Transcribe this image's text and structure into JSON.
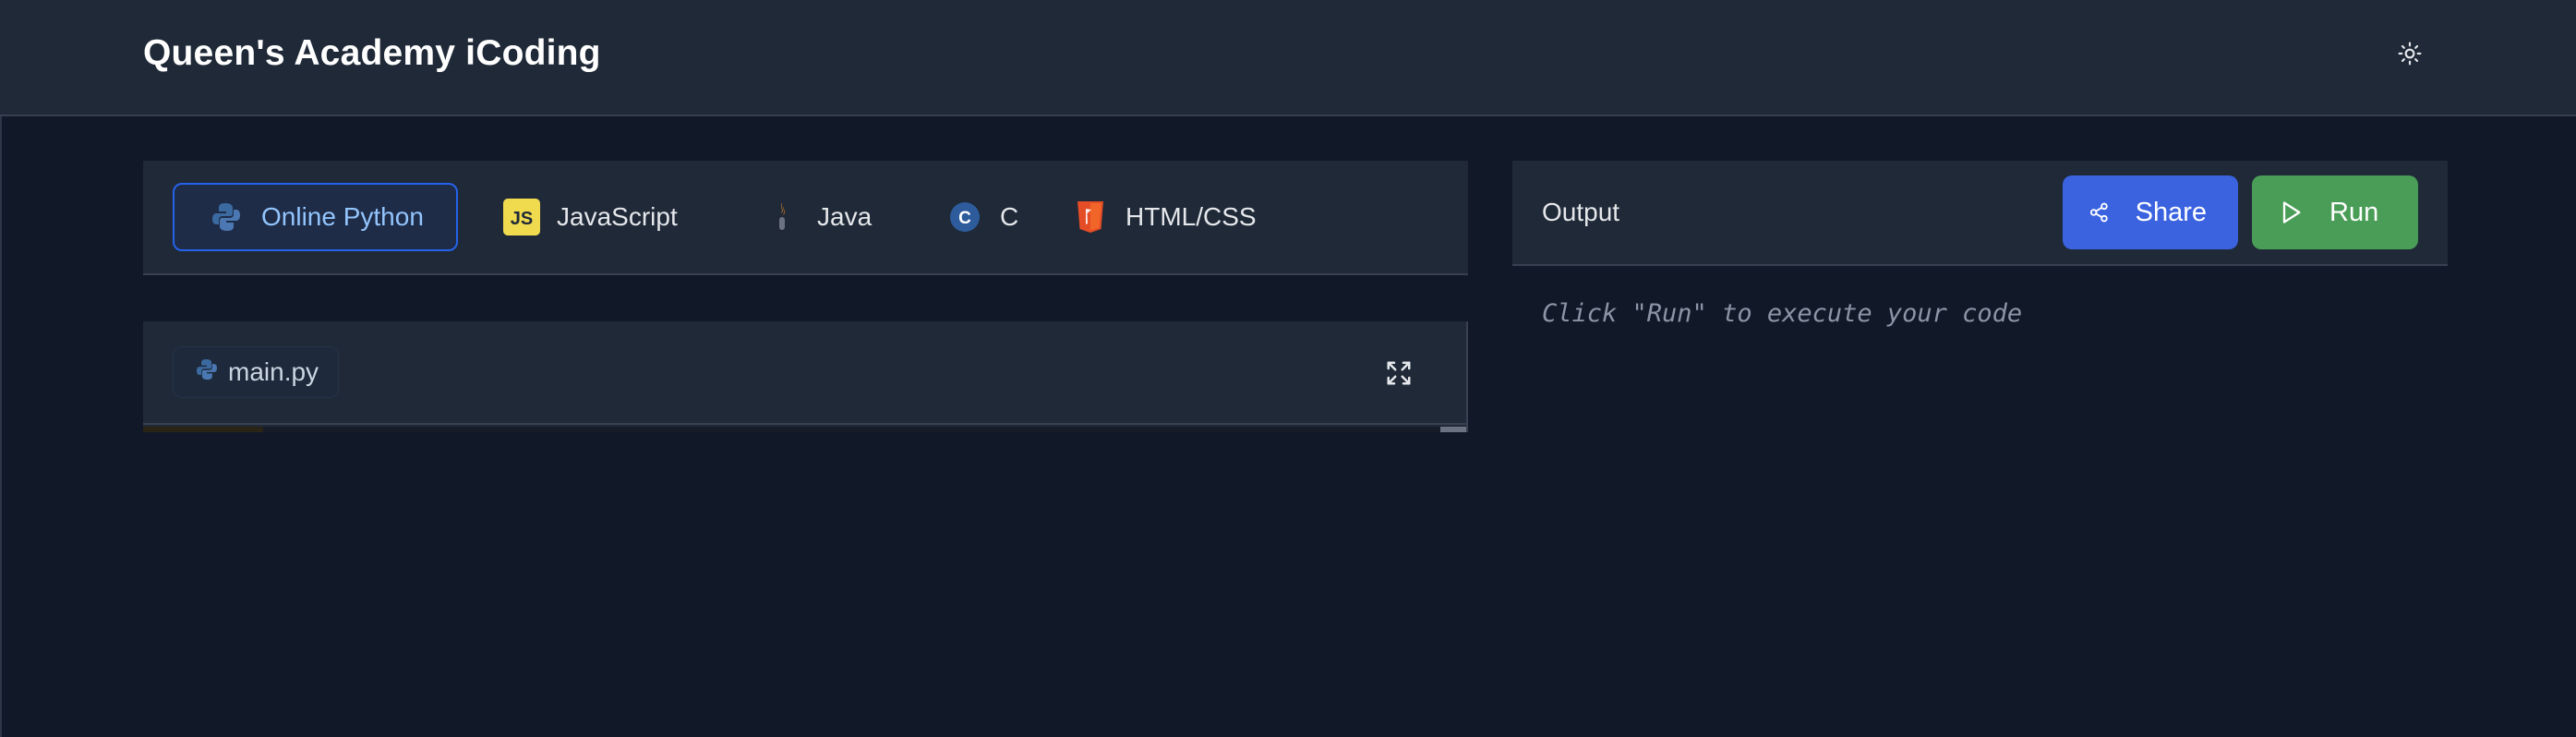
{
  "header": {
    "title": "Queen's Academy iCoding",
    "theme_toggle_icon": "sun-icon"
  },
  "languages": {
    "tabs": [
      {
        "label": "Online Python",
        "icon": "python-icon",
        "active": true
      },
      {
        "label": "JavaScript",
        "icon": "javascript-icon",
        "active": false
      },
      {
        "label": "Java",
        "icon": "java-icon",
        "active": false
      },
      {
        "label": "C",
        "icon": "c-icon",
        "active": false
      },
      {
        "label": "HTML/CSS",
        "icon": "html5-icon",
        "active": false
      }
    ]
  },
  "editor": {
    "file_tab": "main.py",
    "file_icon": "python-icon",
    "fullscreen_icon": "expand-icon"
  },
  "output": {
    "title": "Output",
    "share_label": "Share",
    "run_label": "Run",
    "placeholder": "Click \"Run\" to execute your code"
  },
  "colors": {
    "background": "#111827",
    "panel": "#1f2937",
    "accent_blue": "#3b63e0",
    "run_green": "#4a9d57",
    "active_tab_border": "#2563eb"
  }
}
